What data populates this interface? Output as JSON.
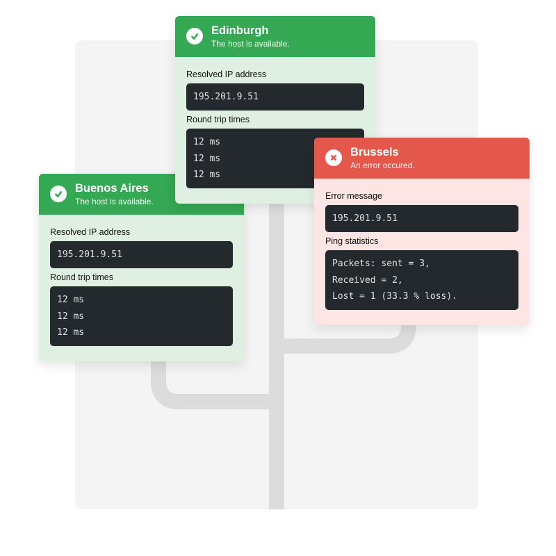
{
  "cards": {
    "edinburgh": {
      "title": "Edinburgh",
      "subtitle": "The host is available.",
      "sections": {
        "ip_label": "Resolved IP address",
        "ip_value": "195.201.9.51",
        "rtt_label": "Round trip times",
        "rtt_l1": "12 ms",
        "rtt_l2": "12 ms",
        "rtt_l3": "12 ms"
      }
    },
    "brussels": {
      "title": "Brussels",
      "subtitle": "An error occured.",
      "sections": {
        "err_label": "Error message",
        "err_value": "195.201.9.51",
        "stats_label": "Ping statistics",
        "stats_l1": "Packets: sent = 3,",
        "stats_l2": "Received = 2,",
        "stats_l3": "Lost = 1 (33.3 % loss)."
      }
    },
    "buenos": {
      "title": "Buenos Aires",
      "subtitle": "The host is available.",
      "sections": {
        "ip_label": "Resolved IP address",
        "ip_value": "195.201.9.51",
        "rtt_label": "Round trip times",
        "rtt_l1": "12 ms",
        "rtt_l2": "12 ms",
        "rtt_l3": "12 ms"
      }
    }
  }
}
